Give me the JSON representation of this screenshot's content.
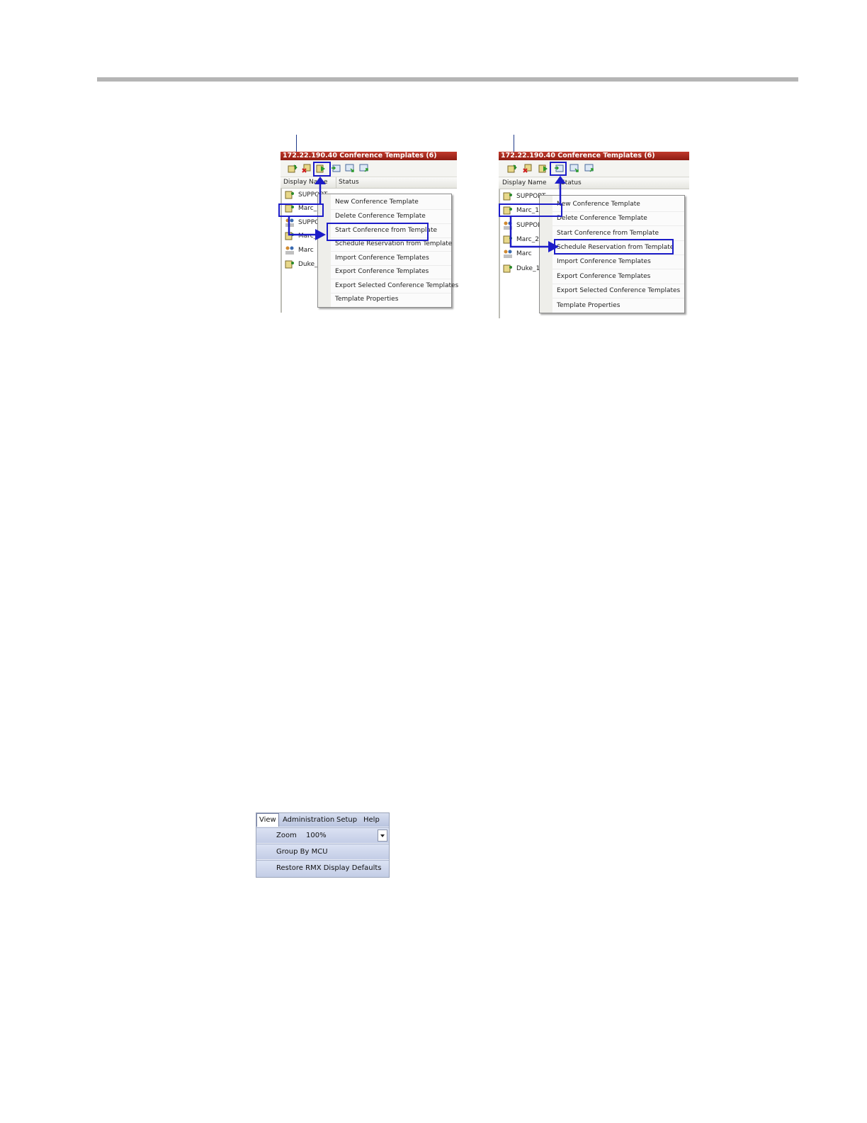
{
  "left_panel": {
    "title": "172.22.190.40 Conference Templates (6)",
    "columns": [
      "Display Name",
      "Status"
    ],
    "rows": [
      "SUPPORT",
      "Marc_1",
      "SUPPORT",
      "Marc_2",
      "Marc",
      "Duke_1"
    ],
    "menu": [
      "New Conference Template",
      "Delete Conference Template",
      "Start Conference from Template",
      "Schedule Reservation from Template",
      "Import Conference Templates",
      "Export Conference Templates",
      "Export Selected Conference Templates",
      "Template Properties"
    ],
    "highlighted_menu_item": "Start Conference from Template"
  },
  "right_panel": {
    "title": "172.22.190.40 Conference Templates (6)",
    "columns": [
      "Display Name",
      "Status"
    ],
    "rows": [
      "SUPPORT",
      "Marc_1",
      "SUPPORT",
      "Marc_2",
      "Marc",
      "Duke_1"
    ],
    "menu": [
      "New Conference Template",
      "Delete Conference Template",
      "Start Conference from Template",
      "Schedule Reservation from Template",
      "Import Conference Templates",
      "Export Conference Templates",
      "Export Selected Conference Templates",
      "Template Properties"
    ],
    "highlighted_menu_item": "Schedule Reservation from Template"
  },
  "view_menu": {
    "menubar": [
      "View",
      "Administration",
      "Setup",
      "Help"
    ],
    "zoom_label": "Zoom",
    "zoom_value": "100%",
    "items": [
      "Group By MCU",
      "Restore RMX Display Defaults"
    ]
  },
  "colors": {
    "title_bar": "#a8231a",
    "highlight": "#1c1cc8",
    "rule": "#b5b5b5"
  }
}
